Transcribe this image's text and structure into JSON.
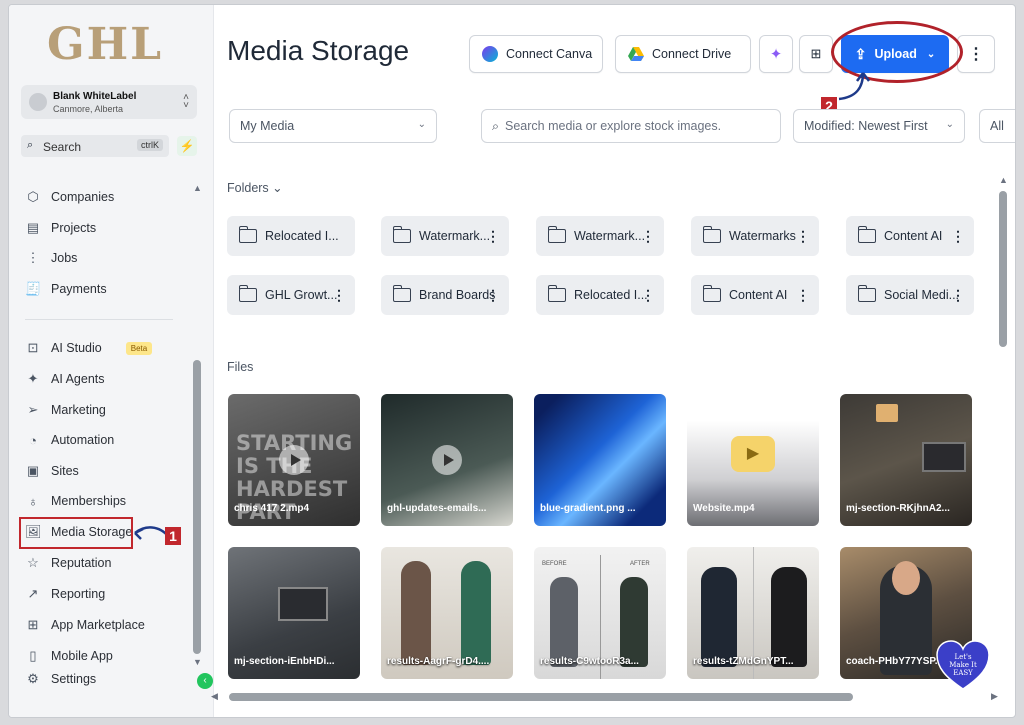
{
  "app": {
    "logo": "GHL",
    "page_title": "Media Storage"
  },
  "account": {
    "name": "Blank WhiteLabel",
    "location": "Canmore, Alberta"
  },
  "sidebar_search": {
    "label": "Search",
    "shortcut": "ctrlK"
  },
  "nav": {
    "companies": "Companies",
    "projects": "Projects",
    "jobs": "Jobs",
    "payments": "Payments",
    "ai_studio": "AI Studio",
    "ai_studio_badge": "Beta",
    "ai_agents": "AI Agents",
    "marketing": "Marketing",
    "automation": "Automation",
    "sites": "Sites",
    "memberships": "Memberships",
    "media_storage": "Media Storage",
    "reputation": "Reputation",
    "reporting": "Reporting",
    "app_marketplace": "App Marketplace",
    "mobile_app": "Mobile App",
    "settings": "Settings"
  },
  "toolbar": {
    "connect_canva": "Connect Canva",
    "connect_drive": "Connect Drive",
    "upload": "Upload"
  },
  "filters": {
    "source": "My Media",
    "search_placeholder": "Search media or explore stock images.",
    "sort": "Modified: Newest First",
    "type": "All"
  },
  "sections": {
    "folders": "Folders",
    "files": "Files"
  },
  "folders": [
    "Relocated I...",
    "Watermark...",
    "Watermark...",
    "Watermarks",
    "Content AI",
    "GHL Growt...",
    "Brand Boards",
    "Relocated I...",
    "Content AI",
    "Social Medi..."
  ],
  "files": [
    {
      "name": "chris 417 2.mp4",
      "overlay_text": "STARTING IS THE HARDEST PART"
    },
    {
      "name": "ghl-updates-emails..."
    },
    {
      "name": "blue-gradient.png ..."
    },
    {
      "name": "Website.mp4"
    },
    {
      "name": "mj-section-RKjhnA2..."
    },
    {
      "name": "mj-section-iEnbHDi..."
    },
    {
      "name": "results-AagrF-grD4...."
    },
    {
      "name": "results-C9wtooR3a...",
      "overlay_labels": [
        "BEFORE",
        "AFTER"
      ]
    },
    {
      "name": "results-tZMdGnYPT..."
    },
    {
      "name": "coach-PHbY77YSP..."
    }
  ],
  "annotations": {
    "step1": "1",
    "step2": "2",
    "badge": "Let's Make It EASY"
  }
}
